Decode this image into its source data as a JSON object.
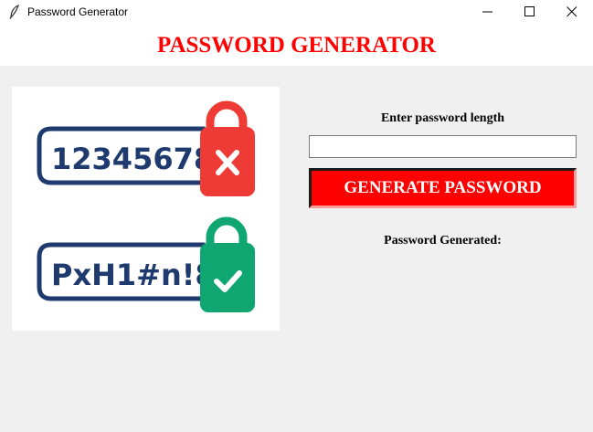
{
  "window": {
    "title": "Password Generator"
  },
  "header": {
    "title": "PASSWORD GENERATOR",
    "title_color": "#ff0000"
  },
  "illustration": {
    "weak_password": "12345678",
    "strong_password": "PxH1#n!8",
    "weak_icon": "locked-padlock-x-icon",
    "strong_icon": "locked-padlock-check-icon",
    "weak_color": "#ef3b36",
    "strong_color": "#0fa672",
    "frame_color": "#1e3a6e"
  },
  "form": {
    "length_label": "Enter password length",
    "length_value": "",
    "generate_label": "GENERATE PASSWORD",
    "button_color": "#ff0000",
    "result_label": "Password Generated:"
  }
}
